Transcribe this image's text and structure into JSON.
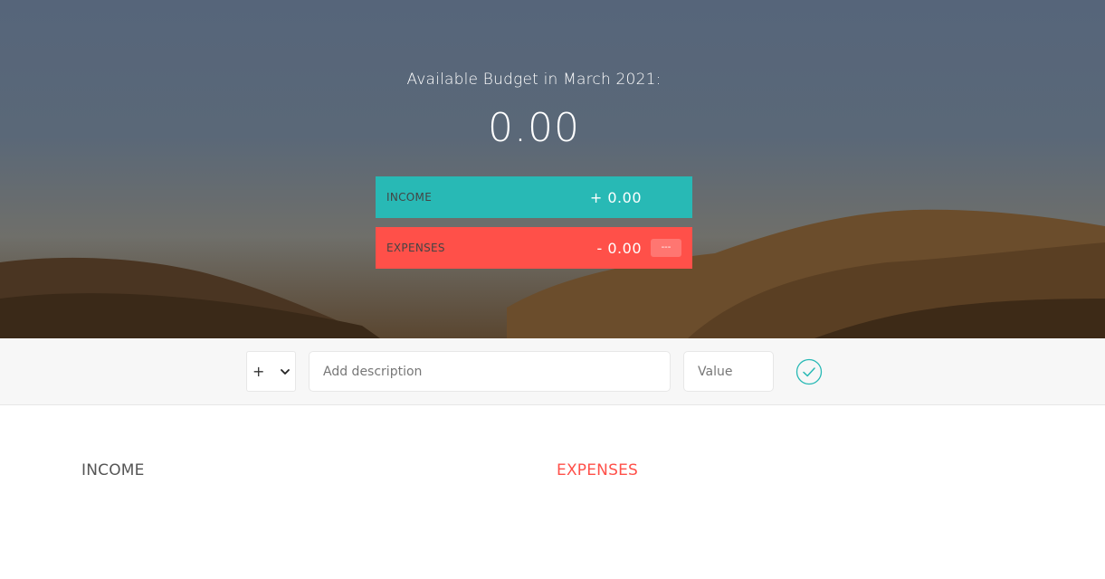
{
  "budget": {
    "title": "Available Budget in March 2021:",
    "value": "0.00",
    "income": {
      "label": "Income",
      "value": "+ 0.00"
    },
    "expenses": {
      "label": "Expenses",
      "value": "- 0.00",
      "percentage": "---"
    }
  },
  "add_bar": {
    "type_selected": "+",
    "description_placeholder": "Add description",
    "value_placeholder": "Value",
    "submit_icon": "check-circle-icon"
  },
  "lists": {
    "income_title": "Income",
    "expenses_title": "Expenses"
  },
  "colors": {
    "income": "#28b9b5",
    "expenses": "#ff5049",
    "add_bar_bg": "#f7f7f7"
  }
}
